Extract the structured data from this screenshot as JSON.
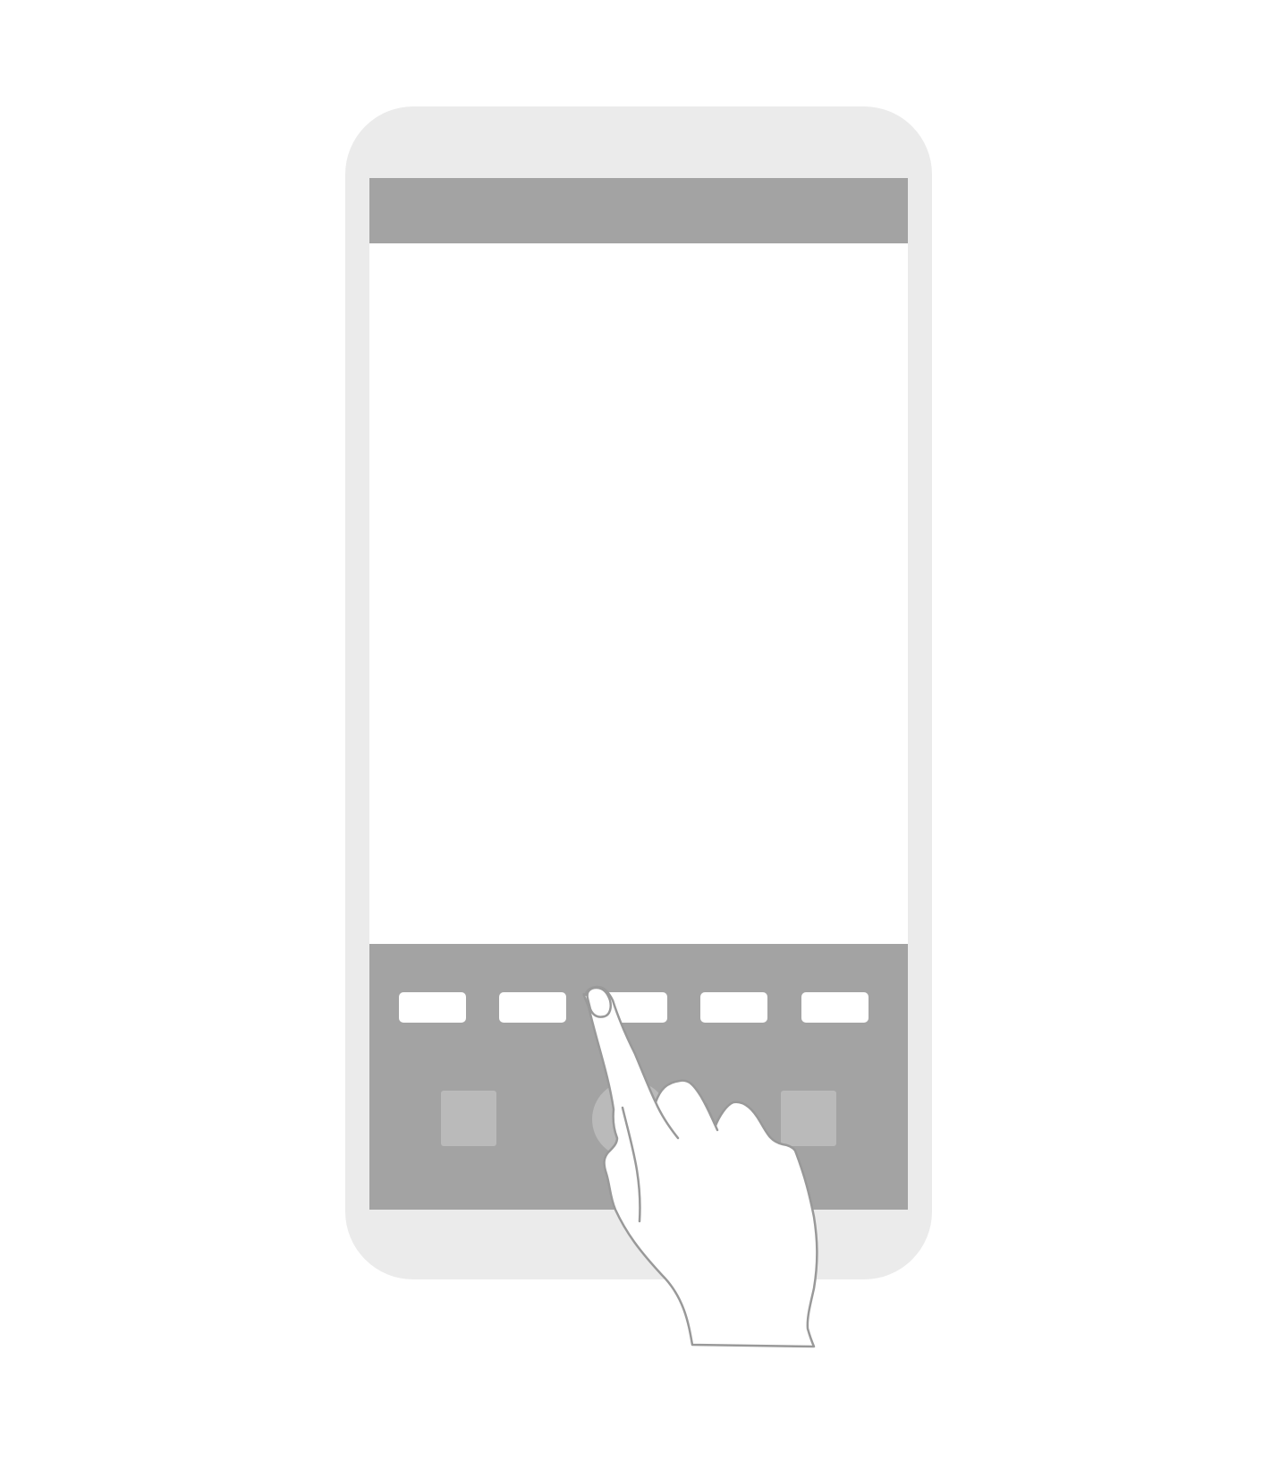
{
  "illustration": {
    "subject": "phone-tap-gesture",
    "colors": {
      "device_frame": "#ebebeb",
      "screen_background": "#ffffff",
      "bars": "#a3a3a3",
      "buttons": "#ffffff",
      "nav_keys": "#bababa",
      "hand_outline": "#999999"
    },
    "bottom_panel": {
      "button_count": 5,
      "nav_keys": [
        "square",
        "circle",
        "square"
      ]
    }
  }
}
